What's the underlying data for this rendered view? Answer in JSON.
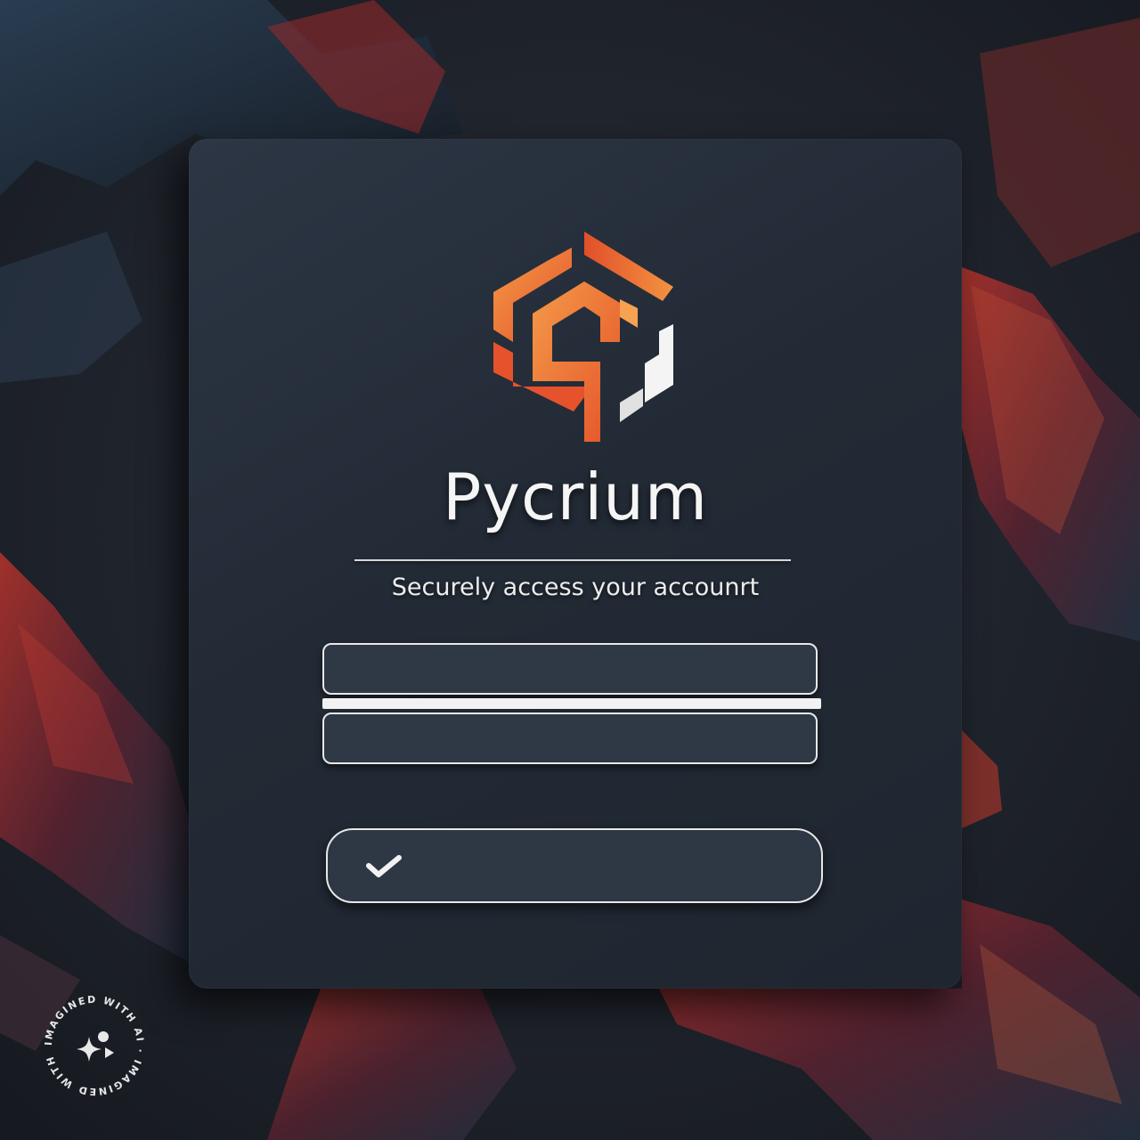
{
  "brand": {
    "name": "Pycrium",
    "tagline": "Securely access your accounrt",
    "colors": {
      "accent_orange": "#f0883a",
      "accent_deep": "#e2562a",
      "panel": "#252d38",
      "field": "#2f3945"
    }
  },
  "form": {
    "field_1": {
      "value": "",
      "placeholder": ""
    },
    "field_2": {
      "value": "",
      "placeholder": ""
    },
    "submit_icon": "checkmark-icon"
  },
  "watermark": {
    "text": "IMAGINED WITH AI · IMAGINED WITH AI ·",
    "icon": "sparkle-icon"
  }
}
